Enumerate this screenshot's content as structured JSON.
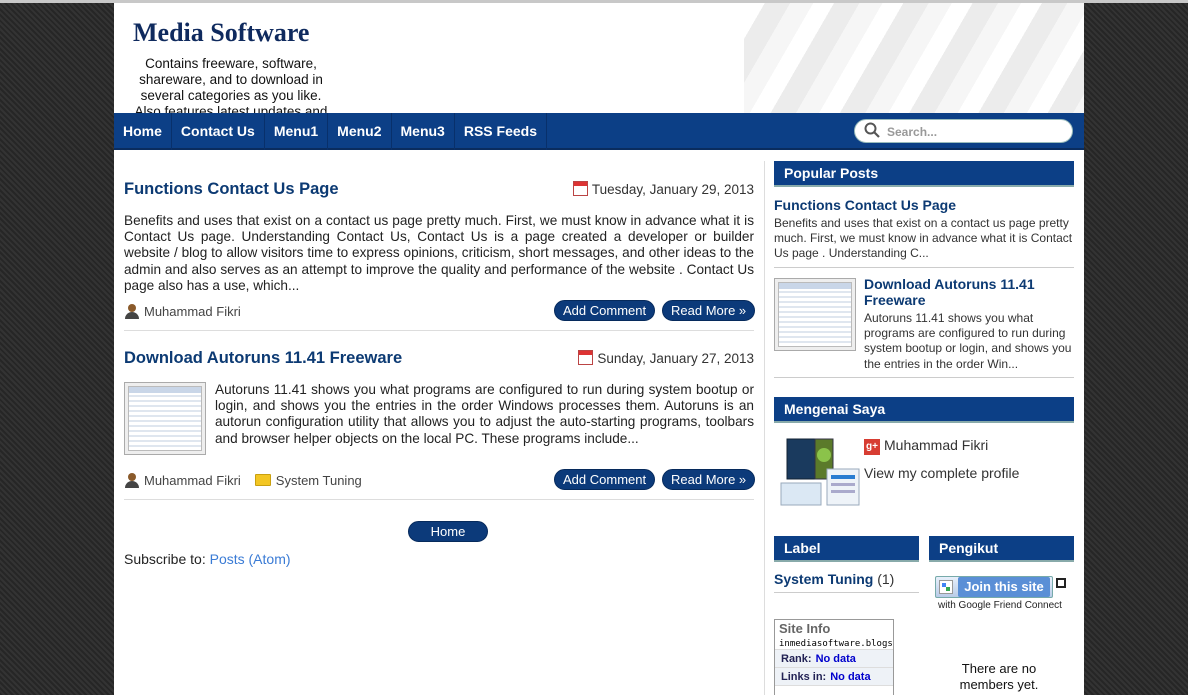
{
  "blog": {
    "title": "Media Software",
    "description": "Contains freeware, software, shareware, and to download in several categories as you like. Also features latest updates and"
  },
  "nav": {
    "items": [
      "Home",
      "Contact Us",
      "Menu1",
      "Menu2",
      "Menu3",
      "RSS Feeds"
    ],
    "search_placeholder": "Search..."
  },
  "posts": [
    {
      "title": "Functions Contact Us Page",
      "date": "Tuesday, January 29, 2013",
      "body": "Benefits and uses that exist on a contact us page pretty much. First, we must know in advance what it is Contact Us page. Understanding Contact Us, Contact Us is a page created a developer or builder website / blog to allow visitors time to express opinions, criticism, short messages, and other ideas to the admin and also serves as an attempt to improve the quality and performance of the website . Contact Us page also has a use, which...",
      "author": "Muhammad Fikri",
      "add_comment": "Add Comment",
      "read_more": "Read More »"
    },
    {
      "title": "Download Autoruns 11.41 Freeware",
      "date": "Sunday, January 27, 2013",
      "body": "Autoruns 11.41 shows you what programs are configured to run during system bootup or login, and shows you the entries in the order Windows processes them.  Autoruns is an autorun configuration utility that allows you to adjust the auto-starting programs, toolbars and browser helper objects on the local PC. These programs include...",
      "author": "Muhammad Fikri",
      "label": "System Tuning",
      "add_comment": "Add Comment",
      "read_more": "Read More »"
    }
  ],
  "pager": {
    "home": "Home"
  },
  "subscribe": {
    "prefix": "Subscribe to: ",
    "link": "Posts (Atom)"
  },
  "sidebar": {
    "popular": {
      "title": "Popular Posts",
      "items": [
        {
          "title": "Functions Contact Us Page",
          "snippet": "Benefits and uses that exist on a contact us page pretty much. First, we must know in advance what it is Contact Us page . Understanding C..."
        },
        {
          "title": "Download Autoruns 11.41 Freeware",
          "snippet": "Autoruns 11.41 shows you what programs are configured to run during system bootup or login, and shows you the entries in the order Win..."
        }
      ]
    },
    "about": {
      "title": "Mengenai Saya",
      "gplus_icon": "g+",
      "name": "Muhammad Fikri",
      "profile_link": "View my complete profile"
    },
    "label": {
      "title": "Label",
      "item": "System Tuning",
      "count": "(1)"
    },
    "followers": {
      "title": "Pengikut",
      "join": "Join this site",
      "gfc": "with Google Friend Connect",
      "no_members": "There are no members yet."
    },
    "site_info": {
      "title": "Site Info",
      "url": "inmediasoftware.blogs...",
      "rank_label": "Rank:",
      "rank_value": "No data",
      "links_label": "Links in:",
      "links_value": "No data"
    }
  },
  "colors": {
    "nav_bg": "#0c3f86",
    "title": "#0c3a73",
    "link": "#3a7bd5"
  }
}
